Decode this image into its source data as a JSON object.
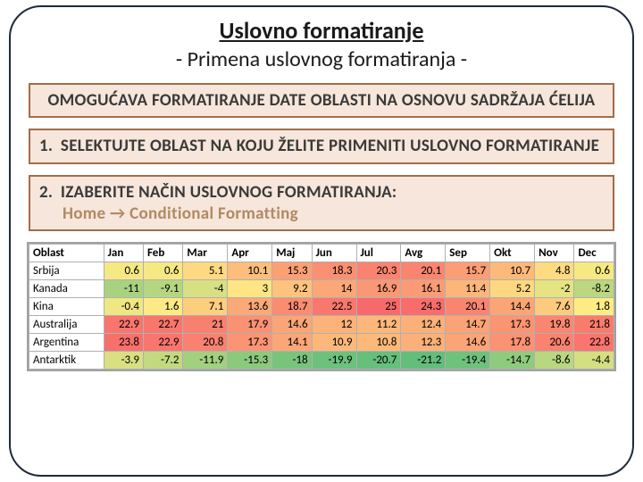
{
  "header": {
    "title": "Uslovno formatiranje",
    "subtitle": "- Primena uslovnog formatiranja -"
  },
  "boxes": {
    "intro": "OMOGUĆAVA FORMATIRANJE DATE OBLASTI NA OSNOVU SADRŽAJA ĆELIJA",
    "step1_num": "1.",
    "step1_text": "SELEKTUJTE OBLAST NA KOJU ŽELITE PRIMENITI USLOVNO FORMATIRANJE",
    "step2_num": "2.",
    "step2_text": "IZABERITE NAČIN USLOVNOG FORMATIRANJA:",
    "step2_sub": "Home → Conditional Formatting"
  },
  "chart_data": {
    "type": "table",
    "title": "",
    "columns": [
      "Oblast",
      "Jan",
      "Feb",
      "Mar",
      "Apr",
      "Maj",
      "Jun",
      "Jul",
      "Avg",
      "Sep",
      "Okt",
      "Nov",
      "Dec"
    ],
    "rows": [
      {
        "label": "Srbija",
        "values": [
          0.6,
          0.6,
          5.1,
          10.1,
          15.3,
          18.3,
          20.3,
          20.1,
          15.7,
          10.7,
          4.8,
          0.6
        ]
      },
      {
        "label": "Kanada",
        "values": [
          -11,
          -9.1,
          -4,
          3,
          9.2,
          14,
          16.9,
          16.1,
          11.4,
          5.2,
          -2,
          -8.2
        ]
      },
      {
        "label": "Kina",
        "values": [
          -0.4,
          1.6,
          7.1,
          13.6,
          18.7,
          22.5,
          25,
          24.3,
          20.1,
          14.4,
          7.6,
          1.8
        ]
      },
      {
        "label": "Australija",
        "values": [
          22.9,
          22.7,
          21,
          17.9,
          14.6,
          12,
          11.2,
          12.4,
          14.7,
          17.3,
          19.8,
          21.8
        ]
      },
      {
        "label": "Argentina",
        "values": [
          23.8,
          22.9,
          20.8,
          17.3,
          14.1,
          10.9,
          10.8,
          12.3,
          14.6,
          17.8,
          20.6,
          22.8
        ]
      },
      {
        "label": "Antarktik",
        "values": [
          -3.9,
          -7.2,
          -11.9,
          -15.3,
          -18,
          -19.9,
          -20.7,
          -21.2,
          -19.4,
          -14.7,
          -8.6,
          -4.4
        ]
      }
    ],
    "heatmap": {
      "scale_type": "green-yellow-red",
      "min_value": -21.2,
      "max_value": 25
    }
  }
}
